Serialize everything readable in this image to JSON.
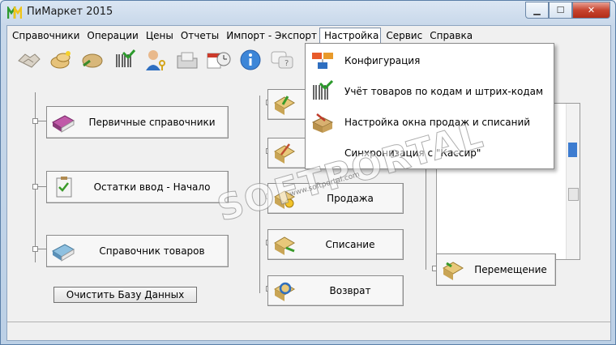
{
  "window": {
    "title": "ПиМаркет 2015",
    "min_icon": "minimize-icon",
    "max_icon": "maximize-icon",
    "close_icon": "close-icon",
    "min_glyph": "▁",
    "max_glyph": "☐",
    "close_glyph": "✕"
  },
  "menu": [
    "Справочники",
    "Операции",
    "Цены",
    "Отчеты",
    "Импорт - Экспорт",
    "Настройка",
    "Сервис",
    "Справка"
  ],
  "open_menu": "Настройка",
  "dropdown": [
    {
      "label": "Конфигурация",
      "icon": "configuration-icon"
    },
    {
      "label": "Учёт товаров по кодам и штрих-кодам",
      "icon": "barcode-icon"
    },
    {
      "label": "Настройка окна продаж и списаний",
      "icon": "toolbox-icon"
    },
    {
      "label": "Синхронизация с \"Кассир\"",
      "icon": "sync-icon"
    }
  ],
  "toolbar": [
    "handshake-icon",
    "coins-icon",
    "money-icon",
    "barcode-icon",
    "user-key-icon",
    "folder-icon",
    "calendar-clock-icon",
    "info-icon",
    "help-icon"
  ],
  "left_items": [
    {
      "label": "Первичные справочники",
      "icon": "books-icon"
    },
    {
      "label": "Остатки ввод - Начало",
      "icon": "clipboard-icon"
    },
    {
      "label": "Справочник товаров",
      "icon": "book-icon"
    }
  ],
  "clear_button": "Очистить Базу Данных",
  "middle_items": [
    {
      "label": "Продажа",
      "icon": "sale-icon"
    },
    {
      "label": "Списание",
      "icon": "writeoff-icon"
    },
    {
      "label": "Возврат",
      "icon": "return-icon"
    }
  ],
  "right_items": [
    {
      "label": "Перемещение",
      "icon": "transfer-icon"
    }
  ],
  "watermark": {
    "text": "SOFTPORTAL",
    "sub": "www.softportal.com"
  }
}
